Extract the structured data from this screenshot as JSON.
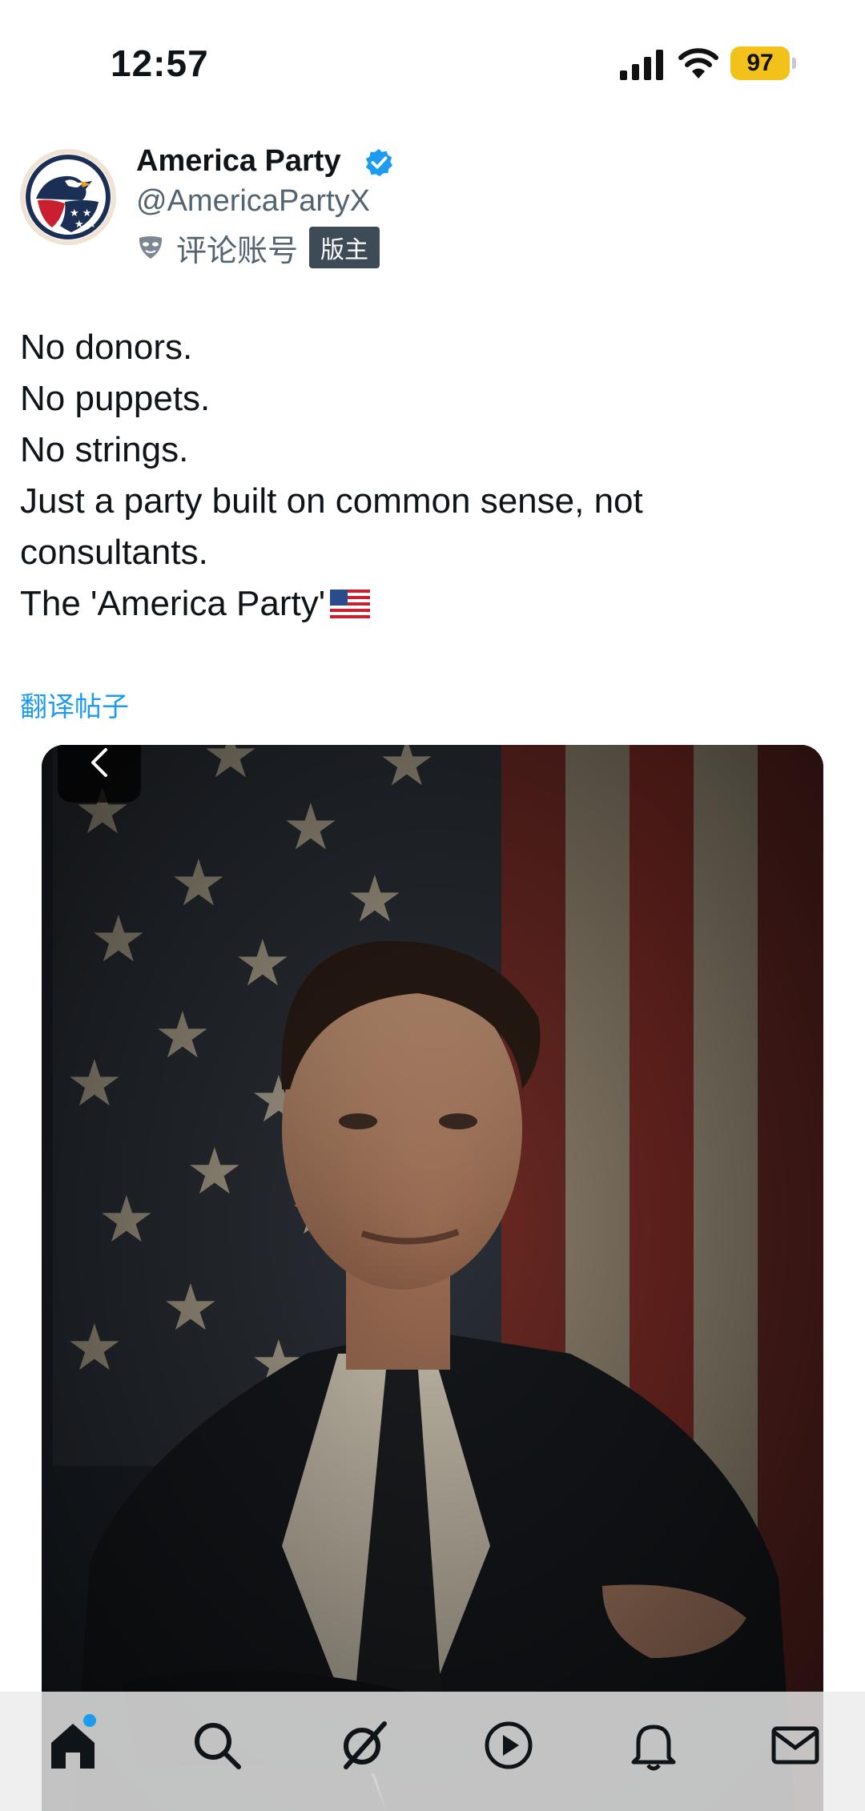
{
  "status_bar": {
    "time": "12:57",
    "battery": "97"
  },
  "account": {
    "name": "America Party",
    "handle": "@AmericaPartyX",
    "sub_label": "评论账号",
    "badge": "版主"
  },
  "tweet": {
    "lines": [
      "No donors.",
      "No puppets.",
      "No strings.",
      "Just a party built on common sense, not",
      "consultants.",
      "The 'America Party'"
    ],
    "translate_link": "翻译帖子"
  },
  "media": {
    "type": "photo"
  },
  "nav": {
    "items": [
      "home-icon",
      "search-icon",
      "grok-icon",
      "video-icon",
      "notifications-icon",
      "messages-icon"
    ]
  },
  "colors": {
    "accent": "#1d9bf0",
    "verified": "#1d9bf0",
    "battery": "#f2c21b"
  }
}
